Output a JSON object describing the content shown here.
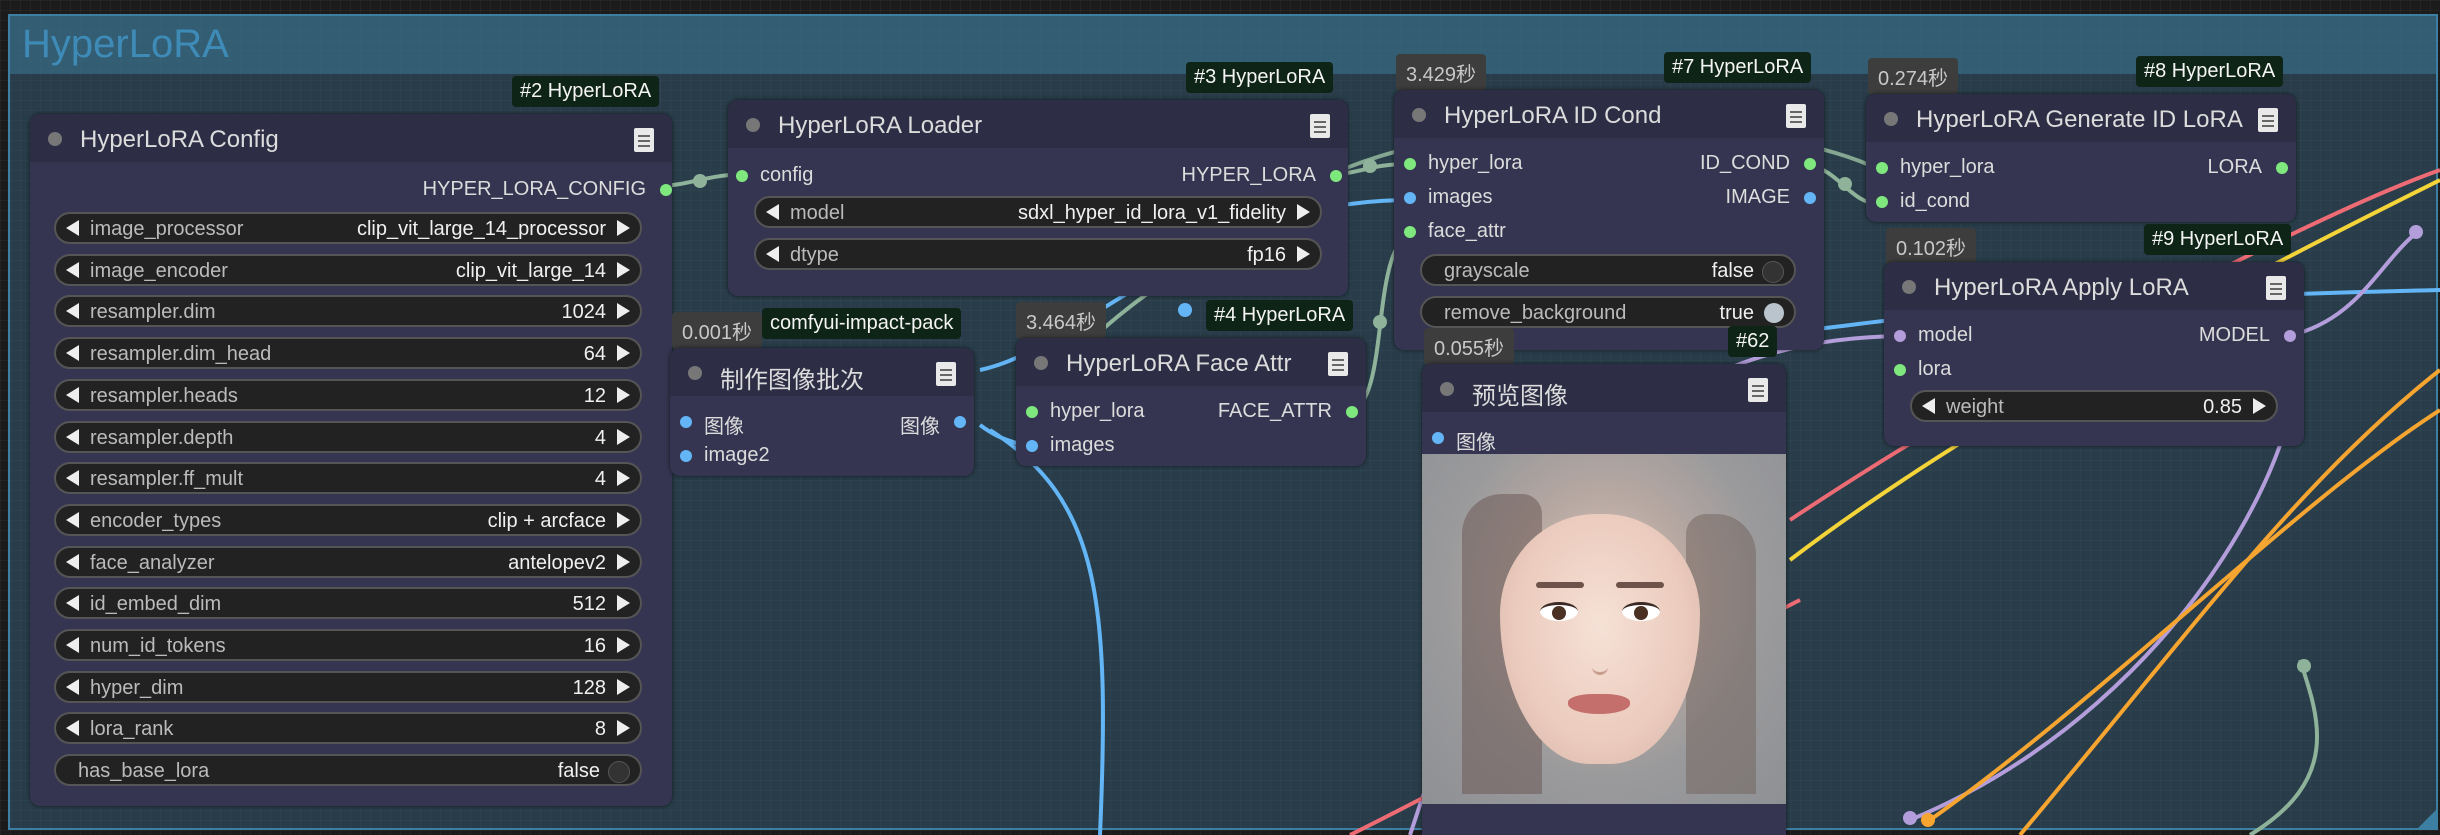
{
  "group": {
    "title": "HyperLoRA"
  },
  "nodes": {
    "config": {
      "badge": "#2 HyperLoRA",
      "title": "HyperLoRA Config",
      "output": "HYPER_LORA_CONFIG",
      "widgets": [
        {
          "label": "image_processor",
          "value": "clip_vit_large_14_processor"
        },
        {
          "label": "image_encoder",
          "value": "clip_vit_large_14"
        },
        {
          "label": "resampler.dim",
          "value": "1024"
        },
        {
          "label": "resampler.dim_head",
          "value": "64"
        },
        {
          "label": "resampler.heads",
          "value": "12"
        },
        {
          "label": "resampler.depth",
          "value": "4"
        },
        {
          "label": "resampler.ff_mult",
          "value": "4"
        },
        {
          "label": "encoder_types",
          "value": "clip + arcface"
        },
        {
          "label": "face_analyzer",
          "value": "antelopev2"
        },
        {
          "label": "id_embed_dim",
          "value": "512"
        },
        {
          "label": "num_id_tokens",
          "value": "16"
        },
        {
          "label": "hyper_dim",
          "value": "128"
        },
        {
          "label": "lora_rank",
          "value": "8"
        }
      ],
      "toggle": {
        "label": "has_base_lora",
        "value": "false"
      }
    },
    "loader": {
      "badge": "#3 HyperLoRA",
      "title": "HyperLoRA Loader",
      "input": "config",
      "output": "HYPER_LORA",
      "widgets": [
        {
          "label": "model",
          "value": "sdxl_hyper_id_lora_v1_fidelity"
        },
        {
          "label": "dtype",
          "value": "fp16"
        }
      ]
    },
    "batch": {
      "timer": "0.001秒",
      "badge": "comfyui-impact-pack",
      "title": "制作图像批次",
      "inputs": [
        "图像",
        "image2"
      ],
      "output": "图像"
    },
    "faceattr": {
      "timer": "3.464秒",
      "badge": "#4 HyperLoRA",
      "title": "HyperLoRA Face Attr",
      "inputs": [
        "hyper_lora",
        "images"
      ],
      "output": "FACE_ATTR"
    },
    "idcond": {
      "timer": "3.429秒",
      "badge": "#7 HyperLoRA",
      "title": "HyperLoRA ID Cond",
      "inputs": [
        "hyper_lora",
        "images",
        "face_attr"
      ],
      "outputs": [
        "ID_COND",
        "IMAGE"
      ],
      "toggles": [
        {
          "label": "grayscale",
          "value": "false"
        },
        {
          "label": "remove_background",
          "value": "true"
        }
      ]
    },
    "preview": {
      "timer": "0.055秒",
      "badge": "#62",
      "title": "预览图像",
      "input": "图像"
    },
    "genid": {
      "timer": "0.274秒",
      "badge": "#8 HyperLoRA",
      "title": "HyperLoRA Generate ID LoRA",
      "inputs": [
        "hyper_lora",
        "id_cond"
      ],
      "output": "LORA"
    },
    "apply": {
      "timer": "0.102秒",
      "badge": "#9 HyperLoRA",
      "title": "HyperLoRA Apply LoRA",
      "inputs": [
        "model",
        "lora"
      ],
      "output": "MODEL",
      "widget": {
        "label": "weight",
        "value": "0.85"
      }
    }
  },
  "colors": {
    "slot_green": "#7ee87e",
    "slot_blue": "#64b5f6",
    "slot_purple": "#b39ddb",
    "wire_green": "#8fb39a",
    "wire_blue": "#64b5f6",
    "wire_purple": "#b39ddb",
    "wire_orange": "#f6a531",
    "wire_yellow": "#f5d43a",
    "wire_red": "#ec6b74"
  }
}
